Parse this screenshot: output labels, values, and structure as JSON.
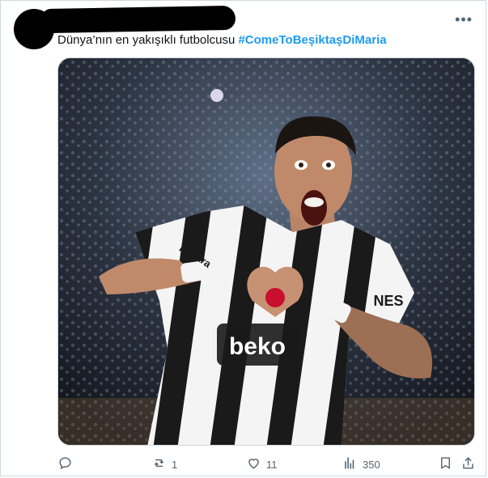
{
  "tweet": {
    "text": "Dünya’nın en yakışıklı futbolcusu ",
    "hashtag": "#ComeToBeşiktaşDiMaria"
  },
  "media": {
    "jersey_sponsor": "beko",
    "jersey_brand": "NES",
    "sleeve_sponsor": "papara"
  },
  "actions": {
    "reply_count": "",
    "retweet_count": "1",
    "like_count": "11",
    "views_count": "350"
  },
  "icons": {
    "more": "more-icon",
    "reply": "reply-icon",
    "retweet": "retweet-icon",
    "like": "heart-icon",
    "views": "views-icon",
    "bookmark": "bookmark-icon",
    "share": "share-icon"
  }
}
